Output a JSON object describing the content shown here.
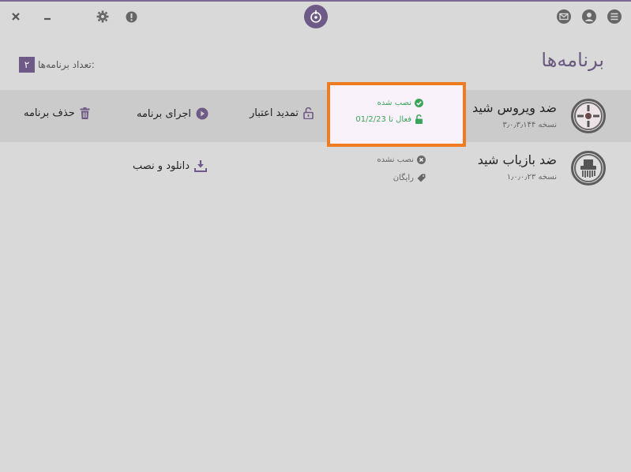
{
  "window": {
    "title_icon": "shield-logo-icon",
    "buttons": [
      "close-icon",
      "minimize-icon",
      "gear-icon",
      "info-icon",
      "mail-icon",
      "user-icon",
      "menu-icon"
    ]
  },
  "header": {
    "title": "برنامه‌ها",
    "count_label": "تعداد برنامه‌ها:",
    "count": "۲"
  },
  "apps": [
    {
      "name": "ضد ویروس شید",
      "version": "نسخه ۳٫۰٫۳٫۱۴۴",
      "status_primary": "نصب شده",
      "status_secondary": "فعال تا 01/2/23",
      "actions": [
        "تمدید اعتبار",
        "اجرای برنامه",
        "حذف برنامه"
      ]
    },
    {
      "name": "ضد بازیاب شید",
      "version": "نسخه ۱٫۰٫۰٫۲۳",
      "status_primary": "نصب نشده",
      "status_secondary": "رایگان",
      "actions": [
        "دانلود و نصب"
      ]
    }
  ],
  "colors": {
    "accent": "#6e5a86",
    "highlight": "#f07c22",
    "ok": "#3aa65a",
    "row_selected": "#cbcbcb",
    "background": "#d9d9d9"
  }
}
